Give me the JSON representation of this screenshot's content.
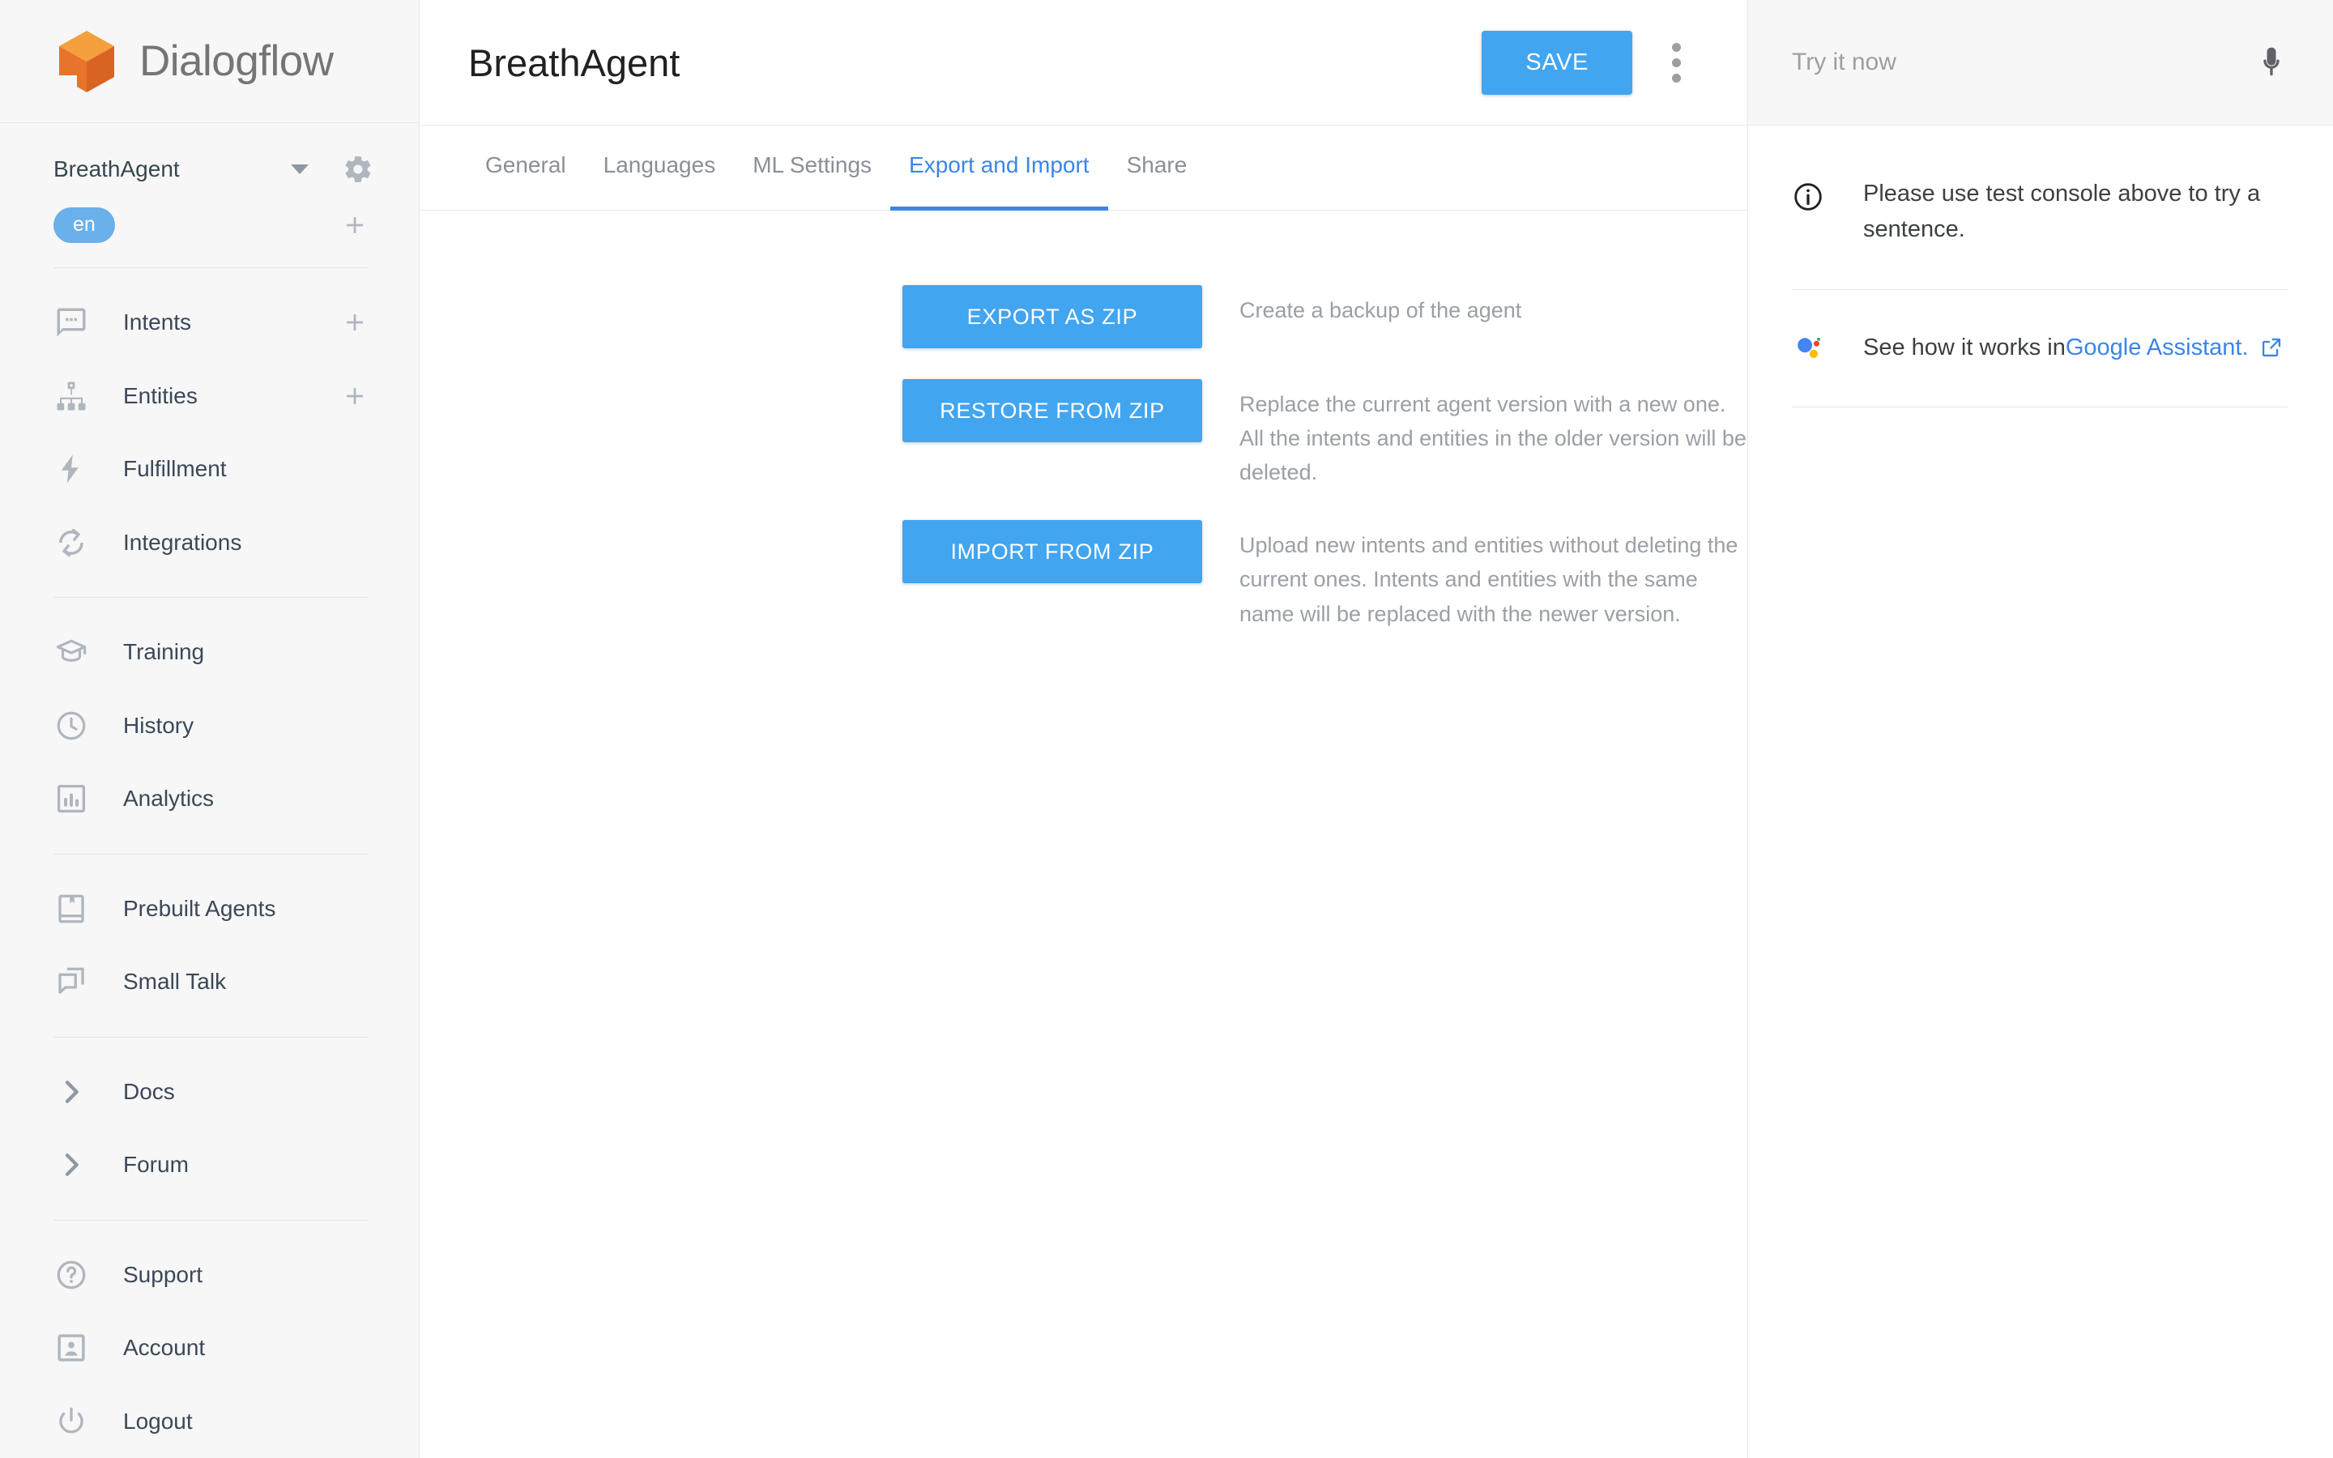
{
  "brand": {
    "name": "Dialogflow",
    "logo_icon": "dialogflow-cube-logo",
    "colors": {
      "logo_top": "#f5a03c",
      "logo_left": "#e8732a",
      "logo_right": "#d96323"
    }
  },
  "sidebar": {
    "agent": {
      "name": "BreathAgent",
      "dropdown_icon": "chevron-down-icon",
      "settings_icon": "gear-icon"
    },
    "language": {
      "code": "en",
      "add_icon": "plus-icon",
      "chip_color": "#6ab0ea"
    },
    "groups": [
      {
        "items": [
          {
            "label": "Intents",
            "icon": "chat-bubble-icon",
            "add": true
          },
          {
            "label": "Entities",
            "icon": "sitemap-icon",
            "add": true
          },
          {
            "label": "Fulfillment",
            "icon": "lightning-bolt-icon",
            "add": false
          },
          {
            "label": "Integrations",
            "icon": "sync-arrows-icon",
            "add": false
          }
        ]
      },
      {
        "items": [
          {
            "label": "Training",
            "icon": "graduation-cap-icon",
            "add": false
          },
          {
            "label": "History",
            "icon": "clock-icon",
            "add": false
          },
          {
            "label": "Analytics",
            "icon": "bar-chart-icon",
            "add": false
          }
        ]
      },
      {
        "items": [
          {
            "label": "Prebuilt Agents",
            "icon": "book-bookmark-icon",
            "add": false
          },
          {
            "label": "Small Talk",
            "icon": "duplicate-chat-icon",
            "add": false
          }
        ]
      },
      {
        "items": [
          {
            "label": "Docs",
            "icon": "chevron-right-icon",
            "add": false
          },
          {
            "label": "Forum",
            "icon": "chevron-right-icon",
            "add": false
          }
        ]
      },
      {
        "items": [
          {
            "label": "Support",
            "icon": "help-circle-icon",
            "add": false
          },
          {
            "label": "Account",
            "icon": "account-box-icon",
            "add": false
          },
          {
            "label": "Logout",
            "icon": "power-icon",
            "add": false
          }
        ]
      }
    ]
  },
  "header": {
    "title": "BreathAgent",
    "save_label": "SAVE",
    "menu_icon": "kebab-menu-icon",
    "accent_color": "#42a5f0"
  },
  "tabs": [
    {
      "label": "General",
      "active": false
    },
    {
      "label": "Languages",
      "active": false
    },
    {
      "label": "ML Settings",
      "active": false
    },
    {
      "label": "Export and Import",
      "active": true
    },
    {
      "label": "Share",
      "active": false
    }
  ],
  "main": {
    "actions": [
      {
        "button": "EXPORT AS ZIP",
        "description": "Create a backup of the agent"
      },
      {
        "button": "RESTORE FROM ZIP",
        "description": "Replace the current agent version with a new one. All the intents and entities in the older version will be deleted."
      },
      {
        "button": "IMPORT FROM ZIP",
        "description": "Upload new intents and entities without deleting the current ones. Intents and entities with the same name will be replaced with the newer version."
      }
    ]
  },
  "right_panel": {
    "try_placeholder": "Try it now",
    "mic_icon": "microphone-icon",
    "info_icon": "info-circle-icon",
    "info_text": "Please use test console above to try a sentence.",
    "assistant_icon": "google-assistant-icon",
    "assistant_prefix": "See how it works in ",
    "assistant_link": "Google Assistant.",
    "external_icon": "external-link-icon",
    "link_color": "#3b85e8"
  }
}
